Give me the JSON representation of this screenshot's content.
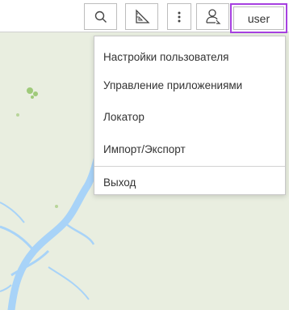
{
  "toolbar": {
    "buttons": [
      {
        "name": "search-icon"
      },
      {
        "name": "measure-ruler-icon"
      },
      {
        "name": "more-vertical-icon"
      },
      {
        "name": "user-account-icon"
      }
    ],
    "user_label": "user"
  },
  "menu": {
    "items": [
      {
        "label": "Настройки пользователя"
      },
      {
        "label": "Управление приложениями"
      },
      {
        "label": "Локатор"
      },
      {
        "label": "Импорт/Экспорт"
      },
      {
        "label": "Выход"
      }
    ]
  },
  "colors": {
    "map_land": "#e9eee0",
    "map_water": "#a8d3f8",
    "map_green": "#9fca7a",
    "user_highlight": "#a640e0"
  }
}
